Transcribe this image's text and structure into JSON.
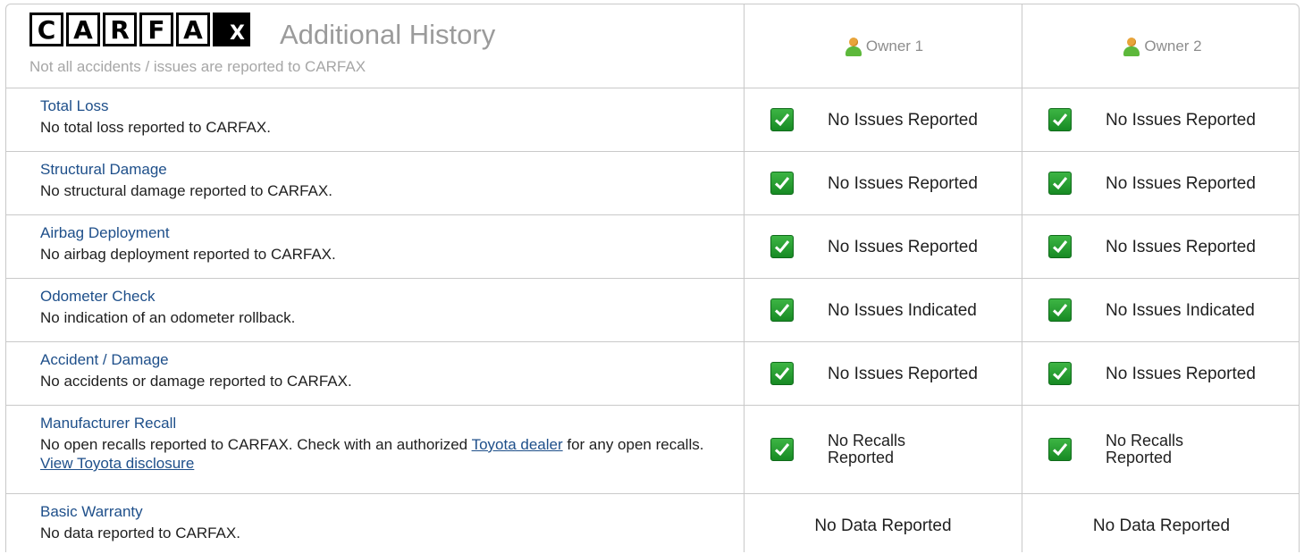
{
  "header": {
    "logo_letters": [
      "C",
      "A",
      "R",
      "F",
      "A",
      "X"
    ],
    "title": "Additional History",
    "subtitle": "Not all accidents / issues are reported to CARFAX",
    "owners": [
      "Owner 1",
      "Owner 2"
    ]
  },
  "rows": [
    {
      "title": "Total Loss",
      "desc": "No total loss reported to CARFAX.",
      "owner1": "No Issues Reported",
      "owner2": "No Issues Reported",
      "checked": true
    },
    {
      "title": "Structural Damage",
      "desc": "No structural damage reported to CARFAX.",
      "owner1": "No Issues Reported",
      "owner2": "No Issues Reported",
      "checked": true
    },
    {
      "title": "Airbag Deployment",
      "desc": "No airbag deployment reported to CARFAX.",
      "owner1": "No Issues Reported",
      "owner2": "No Issues Reported",
      "checked": true
    },
    {
      "title": "Odometer Check",
      "desc": "No indication of an odometer rollback.",
      "owner1": "No Issues Indicated",
      "owner2": "No Issues Indicated",
      "checked": true
    },
    {
      "title": "Accident / Damage",
      "desc": "No accidents or damage reported to CARFAX.",
      "owner1": "No Issues Reported",
      "owner2": "No Issues Reported",
      "checked": true
    },
    {
      "title": "Manufacturer Recall",
      "desc_part1": "No open recalls reported to CARFAX. Check with an authorized ",
      "desc_link1": "Toyota dealer",
      "desc_part2": " for any open recalls. ",
      "desc_link2": "View Toyota disclosure",
      "owner1_line1": "No Recalls",
      "owner1_line2": "Reported",
      "owner2_line1": "No Recalls",
      "owner2_line2": "Reported",
      "checked": true
    },
    {
      "title": "Basic Warranty",
      "desc": "No data reported to CARFAX.",
      "owner1": "No Data Reported",
      "owner2": "No Data Reported",
      "checked": false
    }
  ],
  "colors": {
    "link": "#1e4f8a",
    "check_green": "#2ea13a",
    "border": "#c9c9c9",
    "muted": "#9b9b9b"
  },
  "icons": {
    "owner": "person-icon",
    "status": "green-check-icon"
  }
}
